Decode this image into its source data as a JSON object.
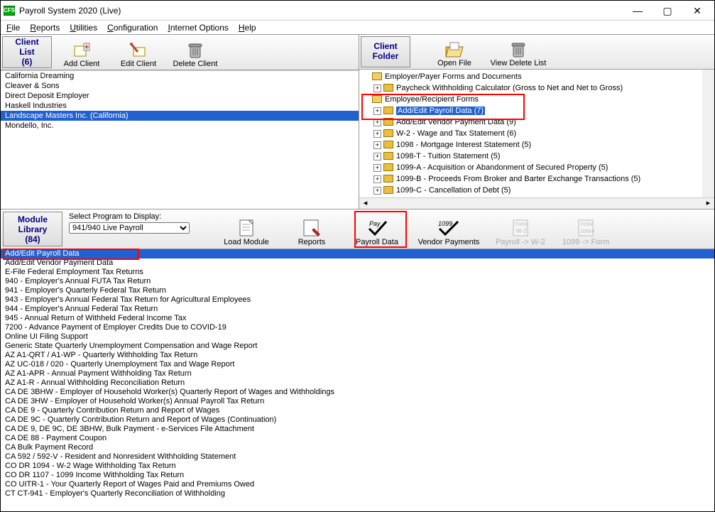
{
  "window": {
    "title": "Payroll System 2020 (Live)",
    "app_icon": "CFS"
  },
  "menubar": {
    "file": "File",
    "reports": "Reports",
    "utilities": "Utilities",
    "configuration": "Configuration",
    "internet": "Internet Options",
    "help": "Help"
  },
  "client_list": {
    "header_line1": "Client",
    "header_line2": "List",
    "header_count": "(6)",
    "add": "Add Client",
    "edit": "Edit Client",
    "del": "Delete Client",
    "items": [
      "California Dreaming",
      "Cleaver & Sons",
      "Direct Deposit Employer",
      "Haskell Industries",
      "Landscape Masters Inc. (California)",
      "Mondello, Inc."
    ],
    "selected_index": 4
  },
  "client_folder": {
    "header_line1": "Client",
    "header_line2": "Folder",
    "open": "Open File",
    "viewdel": "View Delete List",
    "rows": [
      {
        "indent": 0,
        "exp": "",
        "open": true,
        "label": "Employer/Payer Forms and Documents"
      },
      {
        "indent": 1,
        "exp": "+",
        "open": false,
        "label": "Paycheck Withholding Calculator (Gross to Net and Net to Gross)"
      },
      {
        "indent": 0,
        "exp": "",
        "open": true,
        "label": "Employee/Recipient Forms"
      },
      {
        "indent": 1,
        "exp": "+",
        "open": false,
        "label": "Add/Edit Payroll Data  (7)",
        "sel": true
      },
      {
        "indent": 1,
        "exp": "+",
        "open": false,
        "label": "Add/Edit Vendor Payment Data  (9)"
      },
      {
        "indent": 1,
        "exp": "+",
        "open": false,
        "label": "W-2 - Wage and Tax Statement  (6)"
      },
      {
        "indent": 1,
        "exp": "+",
        "open": false,
        "label": "1098 - Mortgage Interest Statement  (5)"
      },
      {
        "indent": 1,
        "exp": "+",
        "open": false,
        "label": "1098-T - Tuition Statement  (5)"
      },
      {
        "indent": 1,
        "exp": "+",
        "open": false,
        "label": "1099-A - Acquisition or Abandonment of Secured Property  (5)"
      },
      {
        "indent": 1,
        "exp": "+",
        "open": false,
        "label": "1099-B - Proceeds From Broker and Barter Exchange Transactions  (5)"
      },
      {
        "indent": 1,
        "exp": "+",
        "open": false,
        "label": "1099-C - Cancellation of Debt  (5)"
      }
    ]
  },
  "module_library": {
    "header_line1": "Module",
    "header_line2": "Library",
    "header_count": "(84)",
    "select_label": "Select Program to Display:",
    "select_value": "941/940 Live Payroll",
    "buttons": {
      "load": "Load Module",
      "reports": "Reports",
      "payroll": "Payroll Data",
      "vendor": "Vendor Payments",
      "pw2": "Payroll -> W-2",
      "p1099": "1099 -> Form"
    },
    "items": [
      "Add/Edit Payroll Data",
      "Add/Edit Vendor Payment Data",
      "E-File Federal Employment Tax Returns",
      "940 - Employer's Annual FUTA Tax Return",
      "941 - Employer's Quarterly Federal Tax Return",
      "943 - Employer's Annual Federal Tax Return for Agricultural Employees",
      "944 - Employer's Annual Federal Tax Return",
      "945 - Annual Return of Withheld Federal Income Tax",
      "7200 - Advance Payment of Employer Credits Due to COVID-19",
      "Online UI Filing Support",
      "Generic State Quarterly Unemployment Compensation and Wage Report",
      "AZ A1-QRT / A1-WP - Quarterly Withholding Tax Return",
      "AZ UC-018 / 020 - Quarterly Unemployment Tax and Wage Report",
      "AZ A1-APR - Annual Payment Withholding Tax Return",
      "AZ A1-R - Annual Withholding Reconciliation Return",
      "CA DE 3BHW - Employer of Household Worker(s) Quarterly Report of Wages and Withholdings",
      "CA DE 3HW - Employer of Household Worker(s) Annual Payroll Tax Return",
      "CA DE 9 - Quarterly Contribution Return and Report of Wages",
      "CA DE 9C - Quarterly Contribution Return and Report of Wages (Continuation)",
      "CA DE 9, DE 9C, DE 3BHW, Bulk Payment - e-Services File Attachment",
      "CA DE 88 - Payment Coupon",
      "CA Bulk Payment Record",
      "CA 592 / 592-V - Resident and Nonresident Withholding Statement",
      "CO DR 1094 - W-2 Wage Withholding Tax Return",
      "CO DR 1107 - 1099 Income Withholding Tax Return",
      "CO UITR-1 - Your Quarterly Report of Wages Paid and Premiums Owed",
      "CT CT-941 - Employer's Quarterly Reconciliation of Withholding"
    ],
    "selected_index": 0
  }
}
